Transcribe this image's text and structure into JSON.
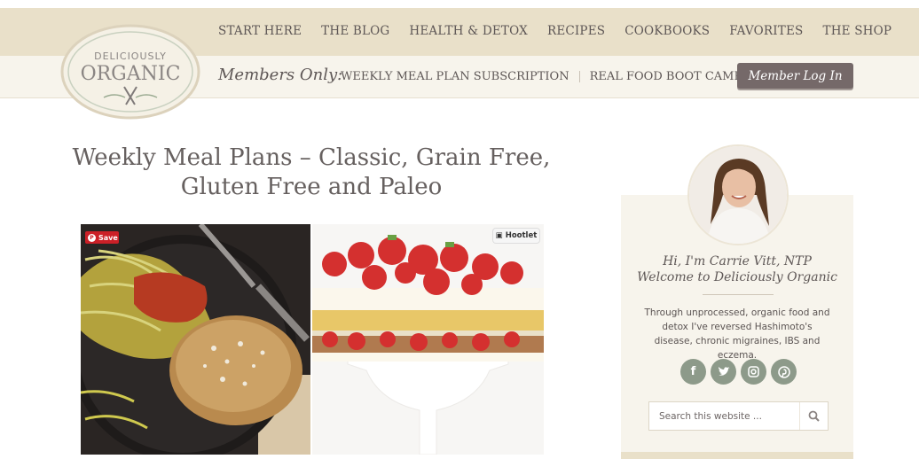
{
  "nav": {
    "items": [
      "START HERE",
      "THE BLOG",
      "HEALTH & DETOX",
      "RECIPES",
      "COOKBOOKS",
      "FAVORITES",
      "THE SHOP"
    ]
  },
  "logo": {
    "line1": "DELICIOUSLY",
    "line2": "ORGANIC"
  },
  "members": {
    "label": "Members Only:",
    "links": [
      "WEEKLY MEAL PLAN SUBSCRIPTION",
      "REAL FOOD BOOT CAMP"
    ],
    "login_button": "Member Log In"
  },
  "post": {
    "title": "Weekly Meal Plans – Classic, Grain Free, Gluten Free and Paleo",
    "save_label": "Save",
    "hootlet_label": "Hootlet"
  },
  "sidebar": {
    "greeting_line1": "Hi, I'm Carrie Vitt, NTP",
    "greeting_line2": "Welcome to Deliciously Organic",
    "bio": "Through unprocessed, organic food and detox I've reversed Hashimoto's disease, chronic migraines, IBS and eczema.",
    "social": [
      {
        "name": "facebook-icon",
        "glyph": "f"
      },
      {
        "name": "twitter-icon",
        "glyph": "t"
      },
      {
        "name": "instagram-icon",
        "glyph": "◎"
      },
      {
        "name": "pinterest-icon",
        "glyph": "p"
      }
    ],
    "search_placeholder": "Search this website ..."
  },
  "colors": {
    "topbar": "#e9e0c9",
    "subbar": "#f7f4ec",
    "button": "#756969",
    "social": "#8d9a8a",
    "pinterest_red": "#cb2027"
  }
}
